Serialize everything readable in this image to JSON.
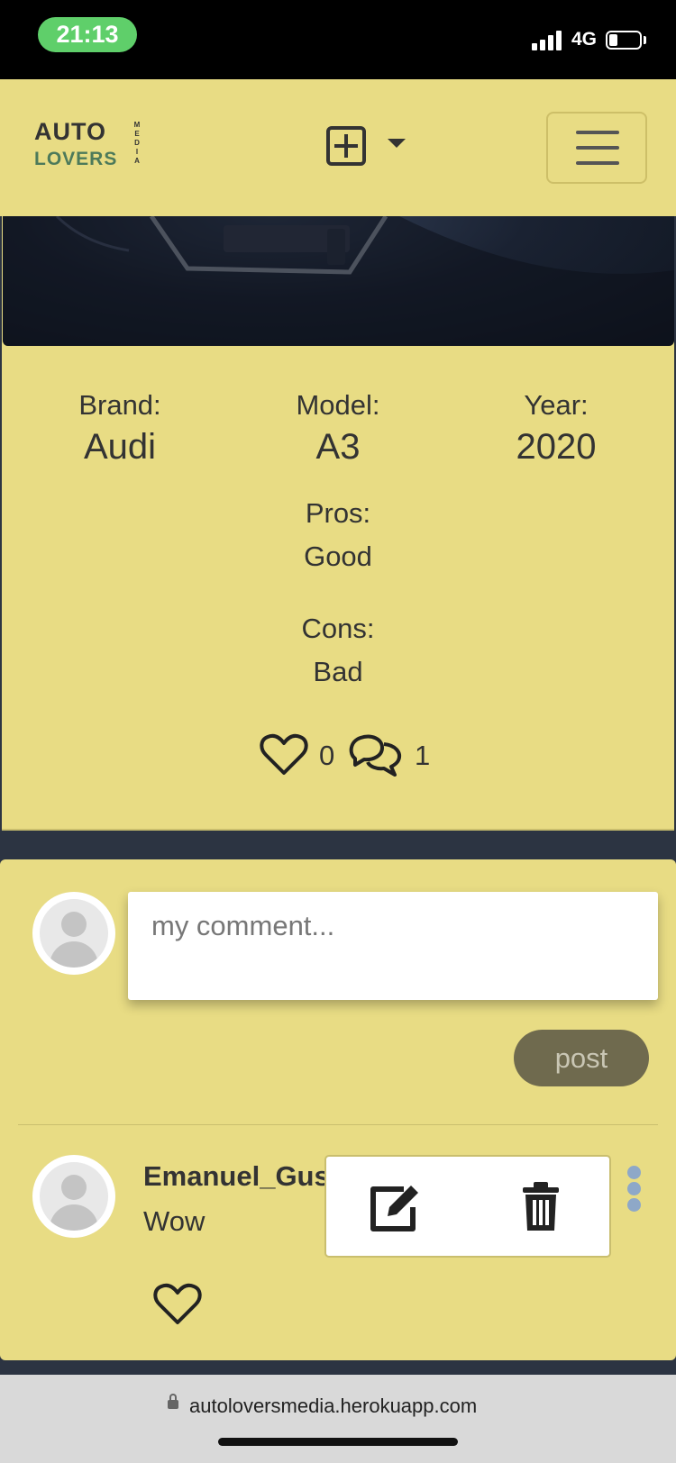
{
  "status_bar": {
    "time": "21:13",
    "network": "4G"
  },
  "navbar": {
    "logo": {
      "line1": "AUTO",
      "line2": "LOVERS",
      "side": "MEDIA"
    },
    "add_menu_icon": "plus-square-icon",
    "caret_icon": "caret-down-icon",
    "menu_icon": "hamburger-icon"
  },
  "post": {
    "brand_label": "Brand:",
    "brand": "Audi",
    "model_label": "Model:",
    "model": "A3",
    "year_label": "Year:",
    "year": "2020",
    "pros_label": "Pros:",
    "pros": "Good",
    "cons_label": "Cons:",
    "cons": "Bad",
    "likes_count": "0",
    "comments_count": "1"
  },
  "comment_form": {
    "placeholder": "my comment...",
    "post_label": "post"
  },
  "comments": [
    {
      "username": "Emanuel_Gus",
      "text": "Wow",
      "actions": [
        "edit-icon",
        "trash-icon"
      ]
    }
  ],
  "browser": {
    "url": "autoloversmedia.herokuapp.com"
  },
  "colors": {
    "accent": "#e8dc84",
    "background": "#2c3442",
    "post_button": "#6f6a4e",
    "dots": "#8ea8c8"
  }
}
